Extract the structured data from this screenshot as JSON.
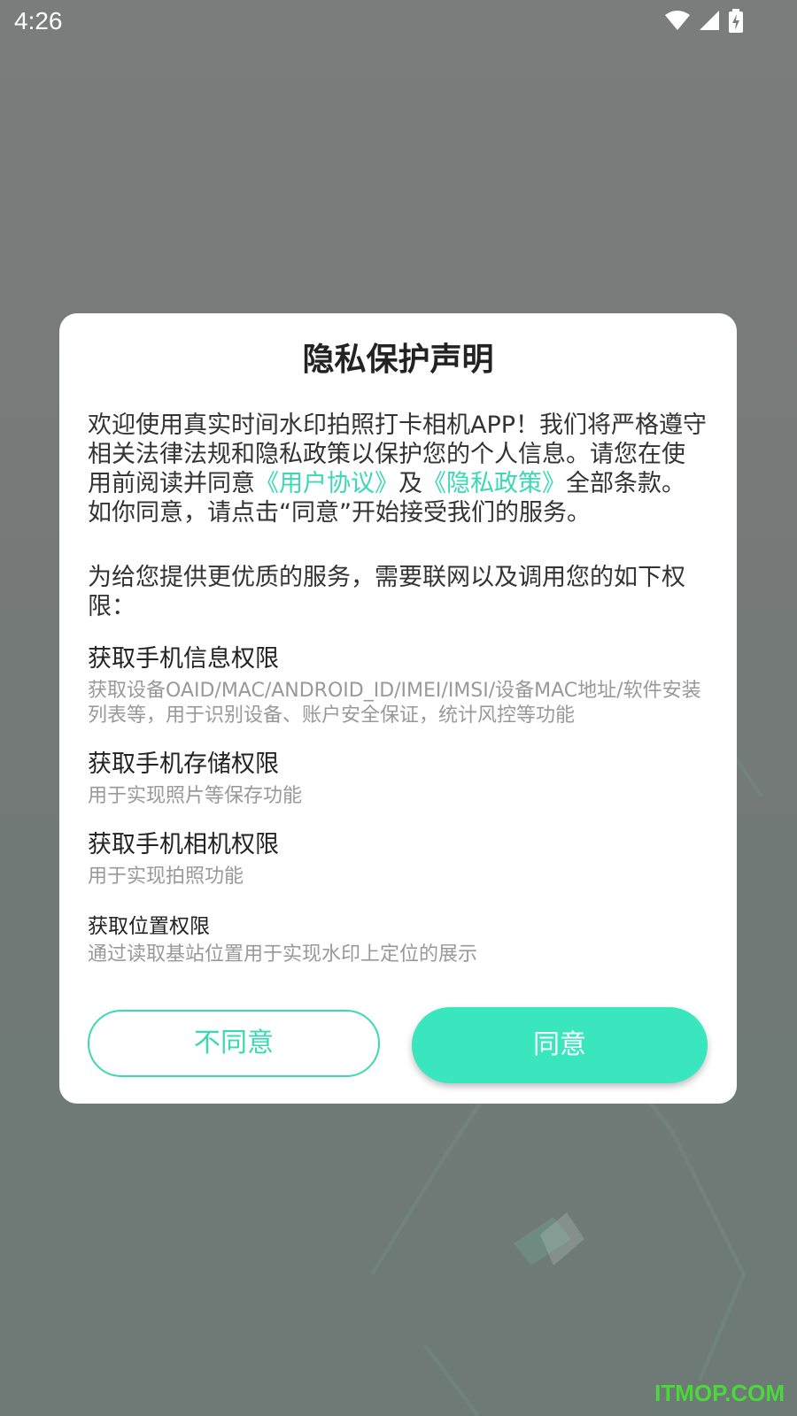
{
  "status": {
    "time": "4:26",
    "icons": [
      "wifi-icon",
      "signal-icon",
      "battery-charging-icon"
    ]
  },
  "dialog": {
    "title": "隐私保护声明",
    "intro": {
      "part1": "欢迎使用真实时间水印拍照打卡相机APP！我们将严格遵守相关法律法规和隐私政策以保护您的个人信息。请您在使用前阅读并同意",
      "user_agreement_link": "《用户协议》",
      "and": "及",
      "privacy_policy_link": "《隐私政策》",
      "part2": "全部条款。如你同意，请点击“同意”开始接受我们的服务。"
    },
    "permissions_lead": "为给您提供更优质的服务，需要联网以及调用您的如下权限：",
    "permissions": [
      {
        "title": "获取手机信息权限",
        "desc": "获取设备OAID/MAC/ANDROID_ID/IMEI/IMSI/设备MAC地址/软件安装列表等，用于识别设备、账户安全保证，统计风控等功能"
      },
      {
        "title": "获取手机存储权限",
        "desc": "用于实现照片等保存功能"
      },
      {
        "title": "获取手机相机权限",
        "desc": "用于实现拍照功能"
      },
      {
        "title": "获取位置权限",
        "desc": "通过读取基站位置用于实现水印上定位的展示"
      }
    ],
    "decline_label": "不同意",
    "agree_label": "同意"
  },
  "watermark": "ITMOP.COM",
  "colors": {
    "accent": "#3ae6bd",
    "link": "#3ad9b3",
    "overlay": "#7a7f7d"
  }
}
